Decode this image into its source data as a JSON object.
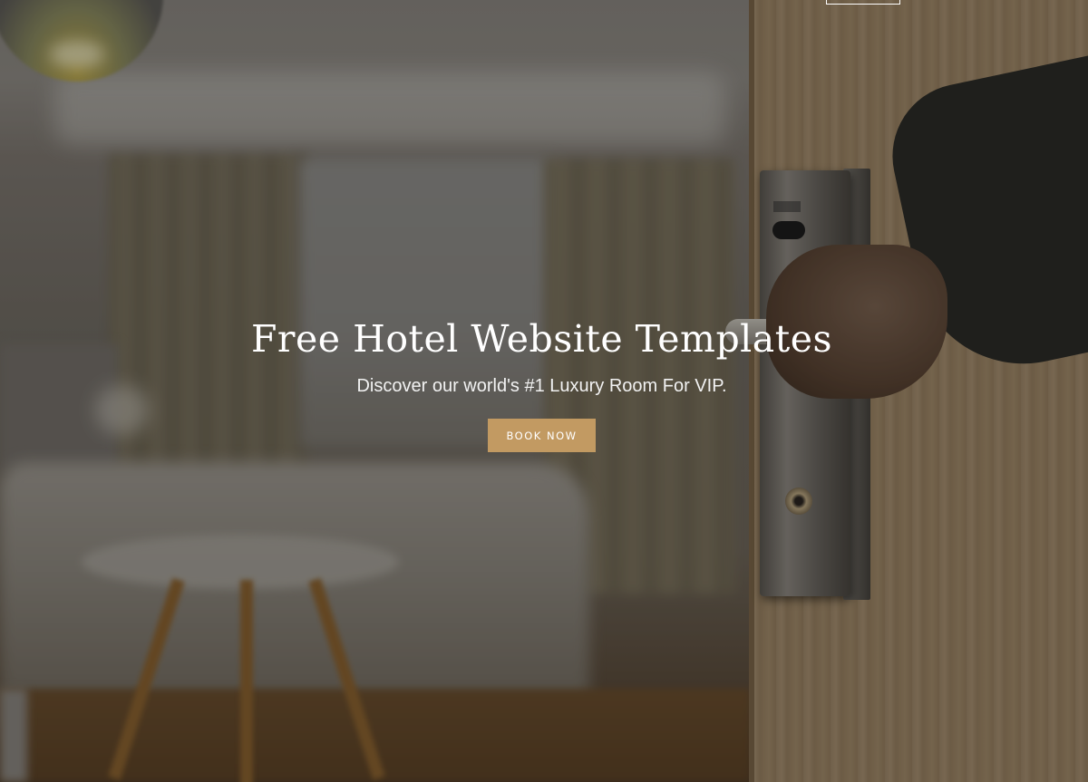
{
  "hero": {
    "title": "Free Hotel Website Templates",
    "subtitle": "Discover our world's #1 Luxury Room For VIP.",
    "cta_label": "BOOK NOW",
    "accent_color": "#c29a62"
  }
}
